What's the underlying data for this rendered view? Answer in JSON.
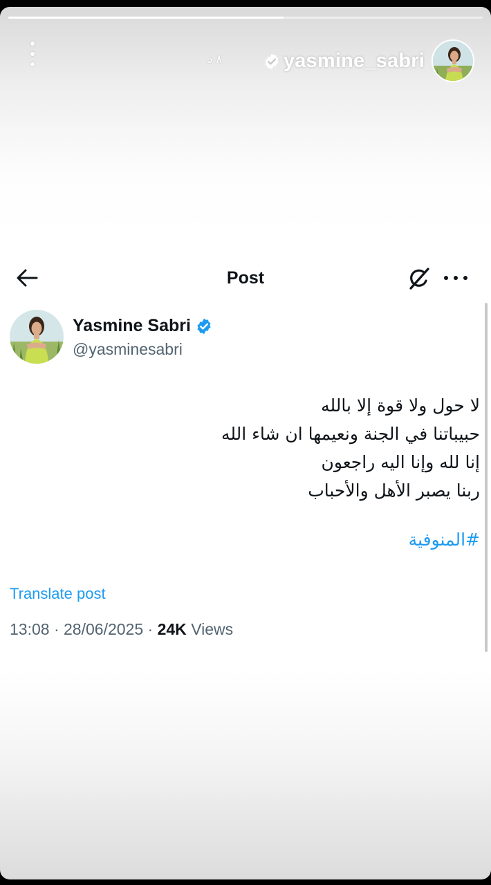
{
  "story": {
    "username": "yasmine_sabri",
    "time_ago": "٨ د",
    "icons": {
      "menu": "more-vertical-icon",
      "verified": "verified-badge-icon"
    }
  },
  "post_header": {
    "title": "Post",
    "icons": {
      "back": "back-arrow-icon",
      "grok": "grok-icon",
      "more": "more-horizontal-icon"
    }
  },
  "author": {
    "name": "Yasmine Sabri",
    "handle": "@yasminesabri"
  },
  "post": {
    "lines": [
      "لا حول ولا قوة إلا بالله",
      "حبيباتنا في الجنة ونعيمها ان شاء الله",
      "إنا لله وإنا اليه راجعون",
      "ربنا يصبر الأهل والأحباب"
    ],
    "hashtag": "#المنوفية",
    "translate_label": "Translate post",
    "time": "13:08",
    "date": "28/06/2025",
    "views_count": "24K",
    "views_label": "Views"
  },
  "colors": {
    "accent": "#1d9bf0",
    "text": "#0f1419",
    "secondary_text": "#536471"
  }
}
